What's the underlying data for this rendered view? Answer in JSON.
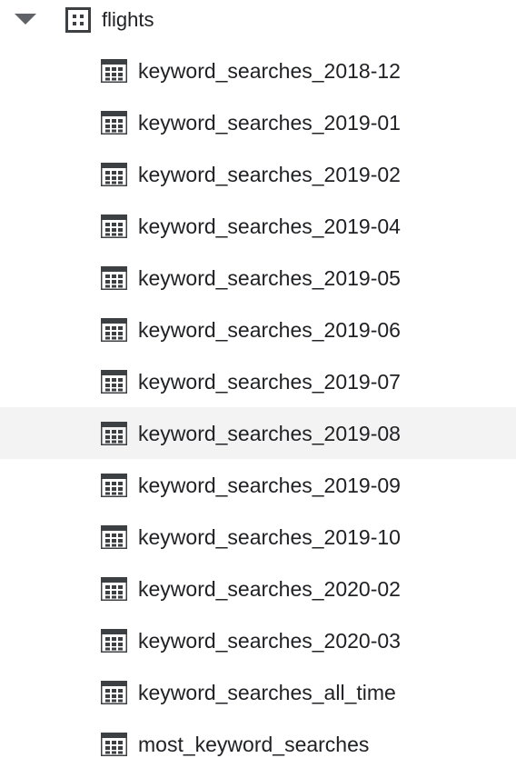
{
  "dataset": {
    "label": "flights",
    "expanded": true,
    "icon": "dataset-icon",
    "caret_icon": "caret-down-icon"
  },
  "tables": [
    {
      "label": "keyword_searches_2018-12",
      "icon": "table-icon",
      "selected": false
    },
    {
      "label": "keyword_searches_2019-01",
      "icon": "table-icon",
      "selected": false
    },
    {
      "label": "keyword_searches_2019-02",
      "icon": "table-icon",
      "selected": false
    },
    {
      "label": "keyword_searches_2019-04",
      "icon": "table-icon",
      "selected": false
    },
    {
      "label": "keyword_searches_2019-05",
      "icon": "table-icon",
      "selected": false
    },
    {
      "label": "keyword_searches_2019-06",
      "icon": "table-icon",
      "selected": false
    },
    {
      "label": "keyword_searches_2019-07",
      "icon": "table-icon",
      "selected": false
    },
    {
      "label": "keyword_searches_2019-08",
      "icon": "table-icon",
      "selected": true
    },
    {
      "label": "keyword_searches_2019-09",
      "icon": "table-icon",
      "selected": false
    },
    {
      "label": "keyword_searches_2019-10",
      "icon": "table-icon",
      "selected": false
    },
    {
      "label": "keyword_searches_2020-02",
      "icon": "table-icon",
      "selected": false
    },
    {
      "label": "keyword_searches_2020-03",
      "icon": "table-icon",
      "selected": false
    },
    {
      "label": "keyword_searches_all_time",
      "icon": "table-icon",
      "selected": false
    },
    {
      "label": "most_keyword_searches",
      "icon": "table-icon",
      "selected": false
    }
  ],
  "colors": {
    "text": "#202124",
    "icon": "#3c4043",
    "caret": "#5f6368",
    "selected_background": "#f3f3f3"
  }
}
